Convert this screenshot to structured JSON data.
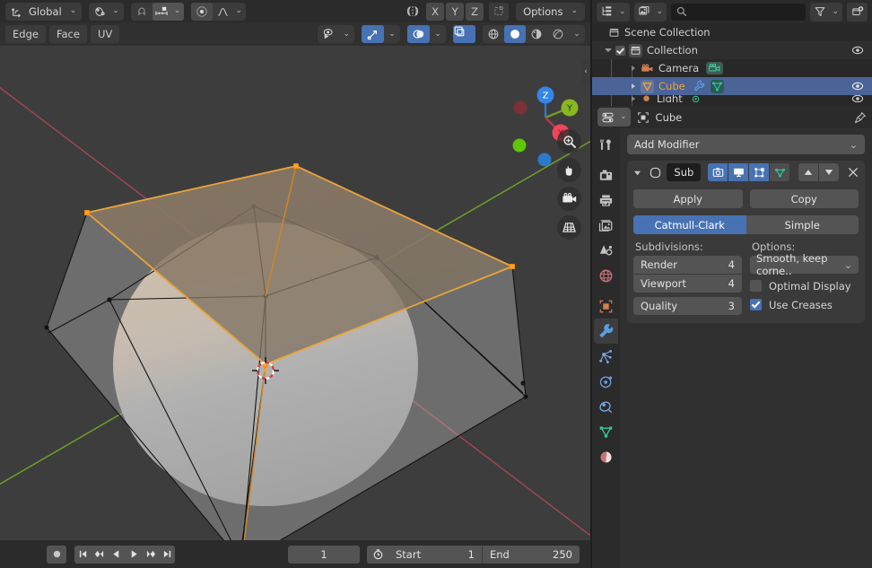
{
  "viewport_header": {
    "transform_orientation": "Global",
    "orientation_icon": "transform-orientation-icon",
    "pivot_icon": "pivot-point-icon",
    "snap_magnet_icon": "snap-magnet-icon",
    "snap_increment_icon": "snap-increment-icon",
    "proportional_edit_icon": "proportional-editing-icon",
    "falloff_icon": "proportional-falloff-icon",
    "mirror_icon": "mesh-symmetry-icon",
    "axis_buttons": [
      "X",
      "Y",
      "Z"
    ],
    "topology_mirror_icon": "topology-mirror-icon",
    "options_label": "Options"
  },
  "mode_tabs": {
    "items": [
      {
        "label": "Edge",
        "name": "tab-edge"
      },
      {
        "label": "Face",
        "name": "tab-face"
      },
      {
        "label": "UV",
        "name": "tab-uv"
      }
    ]
  },
  "viewport_header_right": {
    "visibility_icon": "object-visibility-icon",
    "gizmo_icon": "gizmo-icon",
    "overlays_icon": "overlays-icon",
    "xray_icon": "toggle-xray-icon",
    "shading_wireframe_icon": "shading-wireframe-icon",
    "shading_solid_icon": "shading-solid-icon",
    "shading_material_icon": "shading-material-preview-icon",
    "shading_rendered_icon": "shading-rendered-icon"
  },
  "gizmo": {
    "axes": [
      {
        "label": "Z",
        "color": "#3286e8",
        "name": "gizmo-axis-z"
      },
      {
        "label": "Y",
        "color": "#88b81f",
        "name": "gizmo-axis-y"
      },
      {
        "label": "X",
        "color": "#f0465c",
        "name": "gizmo-axis-x"
      }
    ],
    "negative_axes": [
      {
        "color": "#7c3038",
        "name": "gizmo-axis-neg-x"
      },
      {
        "color": "#5ec603",
        "name": "gizmo-axis-neg-y"
      },
      {
        "color": "#2d79c9",
        "name": "gizmo-axis-neg-z"
      }
    ]
  },
  "nav_buttons": [
    {
      "name": "zoom-view-icon"
    },
    {
      "name": "move-view-icon"
    },
    {
      "name": "camera-view-icon"
    },
    {
      "name": "toggle-perspective-icon"
    }
  ],
  "timeline": {
    "record_icon": "auto-keying-record-icon",
    "jump_start_icon": "jump-to-start-icon",
    "prev_keyframe_icon": "prev-keyframe-icon",
    "play_reverse_icon": "play-reverse-icon",
    "play_icon": "play-icon",
    "next_keyframe_icon": "next-keyframe-icon",
    "jump_end_icon": "jump-to-end-icon",
    "current_frame": "1",
    "timer_icon": "use-preview-range-icon",
    "start_label": "Start",
    "start_value": "1",
    "end_label": "End",
    "end_value": "250"
  },
  "outliner": {
    "display_mode_icon": "outliner-display-mode-icon",
    "filter_id_icon": "outliner-id-type-icon",
    "search_icon": "search-icon",
    "search_value": "",
    "search_placeholder": "",
    "filter_icon": "filter-funnel-icon",
    "new_collection_icon": "new-collection-icon",
    "rows": [
      {
        "name": "Scene Collection",
        "icon": "scene-collection-icon",
        "depth": 0,
        "selected": false,
        "has_eye": false,
        "expander": "none"
      },
      {
        "name": "Collection",
        "icon": "collection-icon",
        "depth": 1,
        "selected": false,
        "has_eye": true,
        "expander": "open",
        "checkbox": true
      },
      {
        "name": "Camera",
        "icon": "camera-object-icon",
        "depth": 2,
        "selected": false,
        "has_eye": true,
        "expander": "closed",
        "data_icons": [
          "camera-data-icon"
        ]
      },
      {
        "name": "Cube",
        "icon": "mesh-object-icon",
        "depth": 2,
        "selected": true,
        "has_eye": true,
        "expander": "closed",
        "data_icons": [
          "modifier-wrench-icon",
          "mesh-data-icon"
        ]
      },
      {
        "name": "Light",
        "icon": "light-object-icon",
        "depth": 2,
        "selected": false,
        "has_eye": true,
        "expander": "closed",
        "data_icons": [
          "light-data-icon"
        ]
      }
    ]
  },
  "properties": {
    "editor_type_icon": "properties-editor-icon",
    "breadcrumb_icon": "object-breadcrumb-icon",
    "breadcrumb_name": "Cube",
    "pin_icon": "pin-id-icon",
    "tabs": [
      {
        "name": "tab-tool",
        "icon": "tool-icon",
        "active": false
      },
      {
        "name": "tab-render",
        "icon": "render-icon",
        "active": false
      },
      {
        "name": "tab-output",
        "icon": "output-printer-icon",
        "active": false
      },
      {
        "name": "tab-view-layer",
        "icon": "view-layer-images-icon",
        "active": false
      },
      {
        "name": "tab-scene",
        "icon": "scene-cone-icon",
        "active": false
      },
      {
        "name": "tab-world",
        "icon": "world-globe-icon",
        "active": false
      },
      {
        "name": "tab-object",
        "icon": "object-square-icon",
        "active": false
      },
      {
        "name": "tab-modifiers",
        "icon": "modifier-wrench-icon",
        "active": true
      },
      {
        "name": "tab-particles",
        "icon": "particles-icon",
        "active": false
      },
      {
        "name": "tab-physics",
        "icon": "physics-icon",
        "active": false
      },
      {
        "name": "tab-constraints",
        "icon": "object-constraints-icon",
        "active": false
      },
      {
        "name": "tab-data",
        "icon": "mesh-data-triangle-icon",
        "active": false
      },
      {
        "name": "tab-material",
        "icon": "material-sphere-icon",
        "active": false
      }
    ],
    "add_modifier_label": "Add Modifier",
    "modifier": {
      "expand_icon": "collapse-triangle-icon",
      "type_icon": "subsurf-modifier-icon",
      "name": "Sub",
      "toggle_render_icon": "display-in-render-icon",
      "toggle_realtime_icon": "display-in-viewport-icon",
      "toggle_edit_icon": "display-in-edit-mode-icon",
      "toggle_cage_icon": "on-cage-icon",
      "move_up_icon": "move-up-icon",
      "move_down_icon": "move-down-icon",
      "close_icon": "delete-modifier-icon",
      "apply_label": "Apply",
      "copy_label": "Copy",
      "algorithm_options": [
        "Catmull-Clark",
        "Simple"
      ],
      "algorithm_selected": "Catmull-Clark",
      "subdivisions_label": "Subdivisions:",
      "options_label": "Options:",
      "levels": [
        {
          "label": "Render",
          "value": "4",
          "name": "render-levels-field"
        },
        {
          "label": "Viewport",
          "value": "4",
          "name": "viewport-levels-field"
        },
        {
          "label": "Quality",
          "value": "3",
          "name": "quality-field"
        }
      ],
      "uv_smooth_value": "Smooth, keep corne..",
      "optimal_display_label": "Optimal Display",
      "optimal_display_checked": false,
      "use_creases_label": "Use Creases",
      "use_creases_checked": true
    }
  },
  "colors": {
    "viewport_bg": "#3d3d3d",
    "selected_orange": "#e8a33d",
    "active_blue": "#4772b3",
    "panel_bg": "#303030",
    "header_bg": "#2b2b2b"
  }
}
